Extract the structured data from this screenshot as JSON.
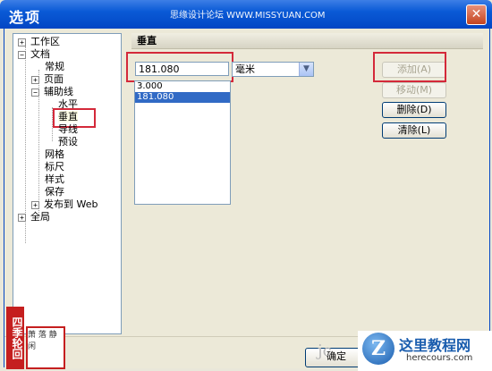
{
  "window": {
    "title": "选项",
    "watermark": "思缘设计论坛 WWW.MISSYUAN.COM",
    "close_label": "✕"
  },
  "tree": {
    "items": [
      {
        "label": "工作区",
        "expander": "+"
      },
      {
        "label": "文档",
        "expander": "−"
      },
      {
        "label": "常规"
      },
      {
        "label": "页面",
        "expander": "+"
      },
      {
        "label": "辅助线",
        "expander": "−"
      },
      {
        "label": "水平"
      },
      {
        "label": "垂直"
      },
      {
        "label": "导线"
      },
      {
        "label": "预设"
      },
      {
        "label": "网格"
      },
      {
        "label": "标尺"
      },
      {
        "label": "样式"
      },
      {
        "label": "保存"
      },
      {
        "label": "发布到 Web",
        "expander": "+"
      },
      {
        "label": "全局",
        "expander": "+"
      }
    ]
  },
  "panel": {
    "title": "垂直",
    "input_value": "181.080",
    "unit": "毫米",
    "list_values": [
      "3.000",
      "181.080"
    ],
    "selected_index": 1
  },
  "buttons": {
    "add": "添加(A)",
    "move": "移动(M)",
    "delete": "删除(D)",
    "clear": "清除(L)",
    "ok": "确定"
  },
  "seal": {
    "red_text": "四季轮回",
    "box_text": "萧 落 静 闲"
  },
  "logo": {
    "mark": "Z",
    "title": "这里教程网",
    "subtitle": "herecours.com",
    "corner_mark": "jc"
  }
}
